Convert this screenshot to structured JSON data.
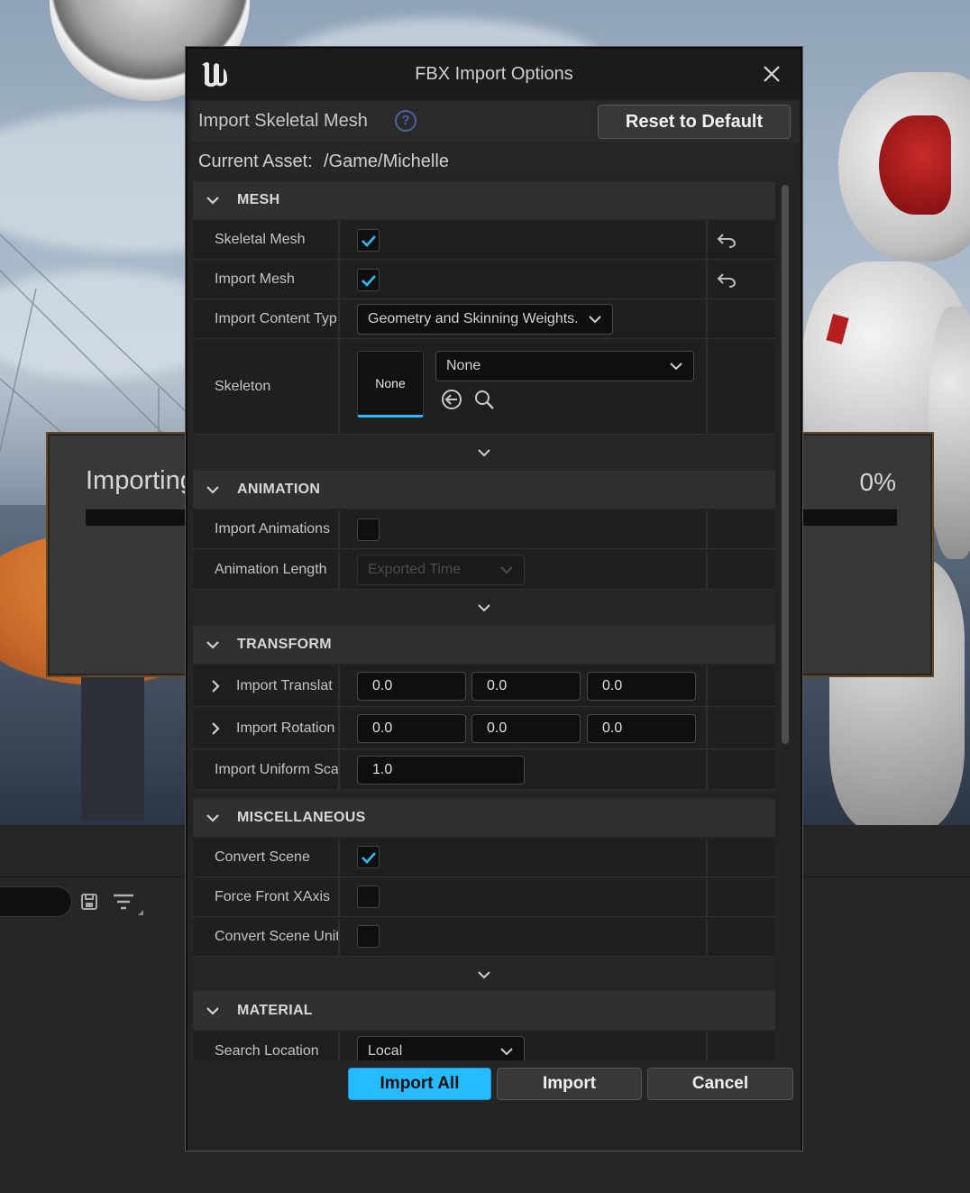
{
  "dialog": {
    "title": "FBX Import Options",
    "import_type_label": "Import Skeletal Mesh",
    "reset_label": "Reset to Default",
    "current_asset_label": "Current Asset:",
    "current_asset_value": "/Game/Michelle"
  },
  "progress": {
    "title": "Importing",
    "percent_text": "0%",
    "fraction": 0.0
  },
  "sections": {
    "mesh": {
      "title": "MESH",
      "skeletal_mesh": {
        "label": "Skeletal Mesh",
        "checked": true
      },
      "import_mesh": {
        "label": "Import Mesh",
        "checked": true
      },
      "import_content_type": {
        "label": "Import Content Typ",
        "value": "Geometry and Skinning Weights."
      },
      "skeleton": {
        "label": "Skeleton",
        "thumb_text": "None",
        "value": "None"
      }
    },
    "animation": {
      "title": "ANIMATION",
      "import_animations": {
        "label": "Import Animations",
        "checked": false
      },
      "animation_length": {
        "label": "Animation Length",
        "value": "Exported Time",
        "disabled": true
      }
    },
    "transform": {
      "title": "TRANSFORM",
      "import_translation": {
        "label": "Import Translat",
        "x": "0.0",
        "y": "0.0",
        "z": "0.0"
      },
      "import_rotation": {
        "label": "Import Rotation",
        "x": "0.0",
        "y": "0.0",
        "z": "0.0"
      },
      "import_uniform_scale": {
        "label": "Import Uniform Sca",
        "value": "1.0"
      }
    },
    "miscellaneous": {
      "title": "MISCELLANEOUS",
      "convert_scene": {
        "label": "Convert Scene",
        "checked": true
      },
      "force_front_xaxis": {
        "label": "Force Front XAxis",
        "checked": false
      },
      "convert_scene_unit": {
        "label": "Convert Scene Unit",
        "checked": false
      }
    },
    "material": {
      "title": "MATERIAL",
      "search_location": {
        "label": "Search Location",
        "value": "Local"
      }
    }
  },
  "buttons": {
    "import_all": "Import All",
    "import": "Import",
    "cancel": "Cancel"
  },
  "colors": {
    "accent": "#26bbff",
    "panel": "#242424",
    "row": "#1f1f1f",
    "section_header": "#303030"
  },
  "icons": {
    "logo": "unreal-logo-icon",
    "close": "close-icon",
    "help": "help-icon",
    "reset": "reset-to-default-arrow-icon",
    "browse_back": "use-selected-asset-icon",
    "search": "search-icon",
    "save": "save-icon",
    "filter": "filter-icon"
  }
}
